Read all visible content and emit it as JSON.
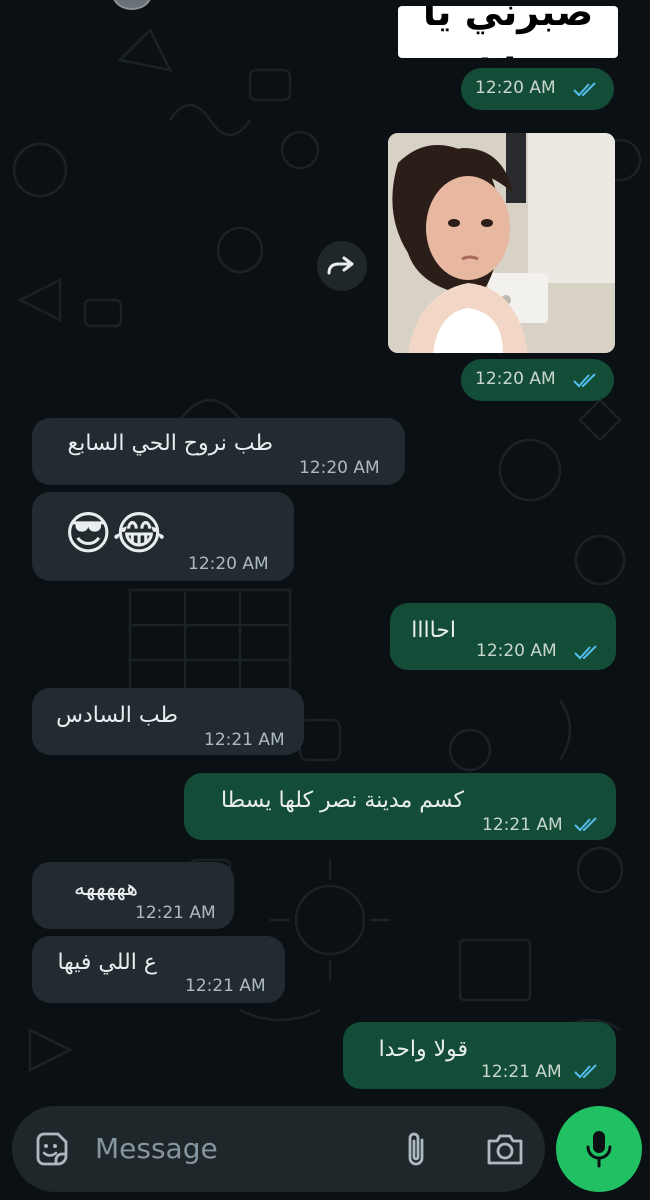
{
  "chat": {
    "sticker_caption": "صبرني يا رب",
    "messages": [
      {
        "direction": "outgoing",
        "kind": "sticker",
        "time": "12:20 AM"
      },
      {
        "direction": "outgoing",
        "kind": "image",
        "time": "12:20 AM"
      },
      {
        "direction": "incoming",
        "text": "طب نروح الحي السابع",
        "time": "12:20 AM"
      },
      {
        "direction": "incoming",
        "text": "😎😂",
        "time": "12:20 AM"
      },
      {
        "direction": "outgoing",
        "text": "احاااا",
        "time": "12:20 AM"
      },
      {
        "direction": "incoming",
        "text": "طب السادس",
        "time": "12:21 AM"
      },
      {
        "direction": "outgoing",
        "text": "كسم مدينة نصر كلها يسطا",
        "time": "12:21 AM"
      },
      {
        "direction": "incoming",
        "text": "هههههه",
        "time": "12:21 AM"
      },
      {
        "direction": "incoming",
        "text": "ع اللي فيها",
        "time": "12:21 AM"
      },
      {
        "direction": "outgoing",
        "text": "قولا واحدا",
        "time": "12:21 AM"
      }
    ]
  },
  "composer": {
    "placeholder": "Message",
    "icons": [
      "sticker-icon",
      "attach-icon",
      "camera-icon",
      "mic-icon"
    ]
  },
  "colors": {
    "background": "#0b1014",
    "outgoing_bubble": "#144d37",
    "incoming_bubble": "#222b30",
    "read_ticks": "#53bdeb",
    "mic_button": "#21c063"
  }
}
